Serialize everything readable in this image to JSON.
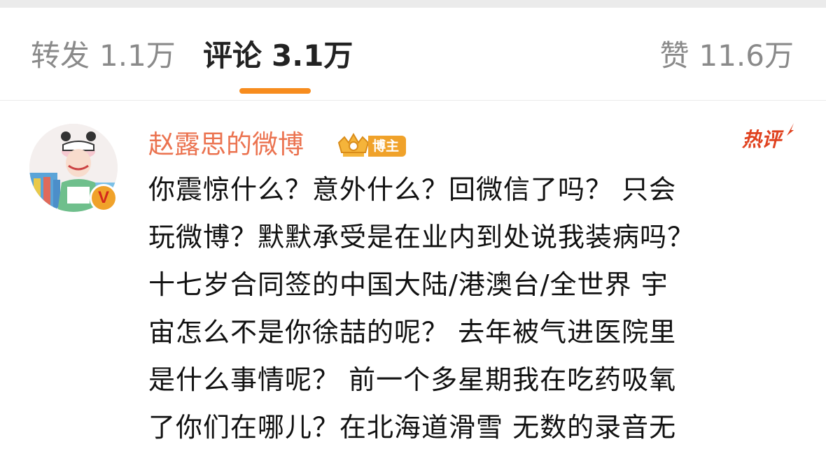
{
  "tabs": {
    "repost": {
      "label": "转发",
      "count": "1.1万"
    },
    "comment": {
      "label": "评论",
      "count": "3.1万"
    },
    "like": {
      "label": "赞",
      "count": "11.6万"
    }
  },
  "comment": {
    "username": "赵露思的微博",
    "blogger_badge": "博主",
    "hot_badge": "热评",
    "verified_mark": "V",
    "lines": [
      "你震惊什么？意外什么？回微信了吗？ 只会",
      "玩微博？默默承受是在业内到处说我装病吗？",
      "十七岁合同签的中国大陆/港澳台/全世界 宇",
      "宙怎么不是你徐喆的呢？ 去年被气进医院里",
      "是什么事情呢？ 前一个多星期我在吃药吸氧",
      "了你们在哪儿？在北海道滑雪 无数的录音无"
    ]
  },
  "colors": {
    "accent": "#f78c1e",
    "username": "#eb7350",
    "hot": "#e0421f",
    "badge": "#f0a22a"
  },
  "icons": {
    "crown": "crown-icon",
    "verified": "verified-badge-icon"
  }
}
